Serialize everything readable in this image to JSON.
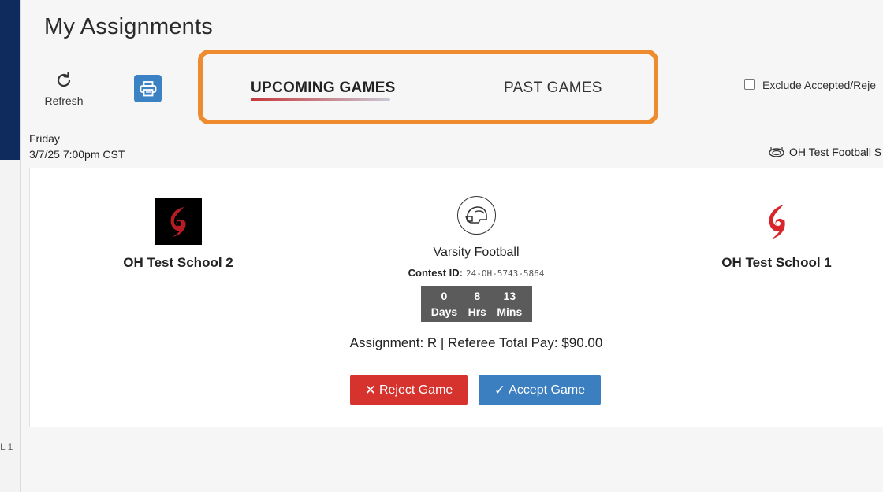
{
  "header": {
    "title": "My Assignments"
  },
  "toolbar": {
    "refresh_label": "Refresh",
    "tabs": [
      {
        "label": "UPCOMING GAMES",
        "active": true
      },
      {
        "label": "PAST GAMES",
        "active": false
      }
    ],
    "exclude_label": "Exclude Accepted/Reje"
  },
  "left_rail": {
    "text": "L 1"
  },
  "game": {
    "day": "Friday",
    "datetime": "3/7/25 7:00pm CST",
    "venue": "OH Test Football S",
    "away_team": "OH Test School 2",
    "home_team": "OH Test School 1",
    "sport": "Varsity Football",
    "contest_label": "Contest ID:",
    "contest_id": "24-OH-5743-5864",
    "countdown": [
      {
        "value": "0",
        "unit": "Days"
      },
      {
        "value": "8",
        "unit": "Hrs"
      },
      {
        "value": "13",
        "unit": "Mins"
      }
    ],
    "assignment": "Assignment: R | Referee  Total Pay: $90.00",
    "reject_label": "Reject Game",
    "accept_label": "Accept Game"
  },
  "colors": {
    "brand_navy": "#0f2a5c",
    "highlight_orange": "#ee8b2f",
    "reject_red": "#d6332f",
    "accept_blue": "#3b7fc0",
    "print_blue": "#3b82c4"
  }
}
